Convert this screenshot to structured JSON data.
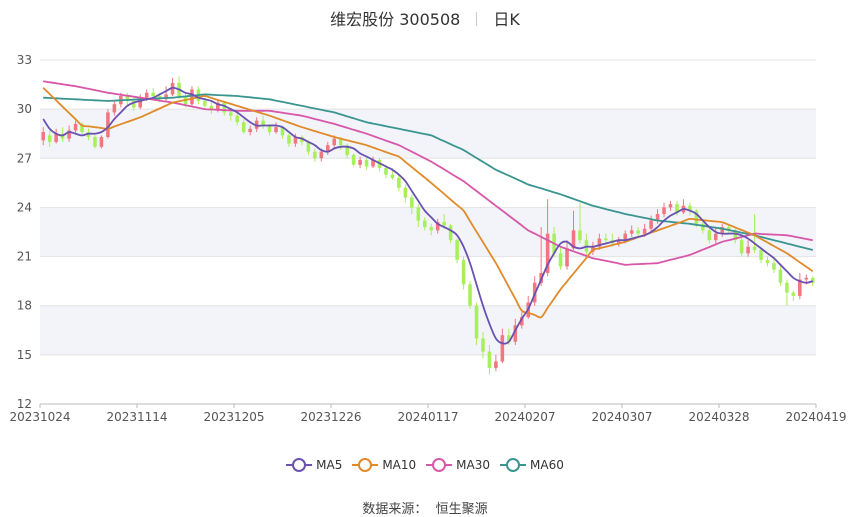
{
  "header": {
    "stock": "维宏股份 300508",
    "period": "日K"
  },
  "source": {
    "label": "数据来源：",
    "name": "恒生聚源"
  },
  "chart_data": {
    "type": "candlestick",
    "yaxis": {
      "min": 12,
      "max": 33,
      "ticks": [
        "12",
        "15",
        "18",
        "21",
        "24",
        "27",
        "30",
        "33"
      ]
    },
    "xaxis_labels": [
      "20231024",
      "20231114",
      "20231205",
      "20231226",
      "20240117",
      "20240207",
      "20240307",
      "20240328",
      "20240419"
    ],
    "colors": {
      "up": "#f0767f",
      "down": "#a8f05a",
      "ma5": "#6a52b0",
      "ma10": "#e08a2a",
      "ma30": "#d857a8",
      "ma60": "#3a9590"
    },
    "legend": [
      {
        "key": "ma5",
        "label": "MA5"
      },
      {
        "key": "ma10",
        "label": "MA10"
      },
      {
        "key": "ma30",
        "label": "MA30"
      },
      {
        "key": "ma60",
        "label": "MA60"
      }
    ],
    "candles": [
      [
        28.1,
        28.6,
        28.9,
        27.8
      ],
      [
        28.4,
        28.0,
        28.7,
        27.7
      ],
      [
        28.0,
        28.5,
        28.8,
        27.9
      ],
      [
        28.5,
        28.2,
        28.9,
        28.0
      ],
      [
        28.2,
        28.7,
        29.0,
        28.0
      ],
      [
        28.7,
        29.1,
        29.3,
        28.5
      ],
      [
        29.1,
        28.6,
        29.2,
        28.4
      ],
      [
        28.6,
        28.3,
        28.8,
        28.1
      ],
      [
        28.3,
        27.7,
        28.4,
        27.6
      ],
      [
        27.7,
        28.3,
        28.4,
        27.6
      ],
      [
        28.3,
        29.8,
        30.0,
        28.2
      ],
      [
        29.8,
        30.3,
        30.5,
        29.6
      ],
      [
        30.3,
        30.8,
        31.0,
        30.1
      ],
      [
        30.8,
        30.5,
        31.0,
        30.2
      ],
      [
        30.5,
        30.1,
        30.7,
        29.9
      ],
      [
        30.1,
        30.7,
        30.9,
        30.0
      ],
      [
        30.7,
        31.0,
        31.2,
        30.5
      ],
      [
        31.0,
        30.8,
        31.3,
        30.6
      ],
      [
        30.8,
        30.6,
        31.0,
        30.4
      ],
      [
        30.6,
        30.9,
        31.4,
        30.5
      ],
      [
        30.9,
        31.6,
        31.9,
        30.8
      ],
      [
        31.6,
        30.8,
        32.0,
        30.6
      ],
      [
        30.8,
        30.3,
        31.0,
        30.1
      ],
      [
        30.3,
        31.2,
        31.4,
        30.2
      ],
      [
        31.2,
        30.5,
        31.4,
        30.3
      ],
      [
        30.5,
        30.2,
        30.7,
        30.0
      ],
      [
        30.2,
        30.0,
        30.4,
        29.7
      ],
      [
        30.0,
        30.4,
        30.6,
        29.8
      ],
      [
        30.4,
        29.8,
        30.5,
        29.6
      ],
      [
        29.8,
        29.6,
        30.0,
        29.3
      ],
      [
        29.6,
        29.2,
        29.8,
        29.0
      ],
      [
        29.2,
        28.6,
        29.4,
        28.5
      ],
      [
        28.6,
        28.8,
        29.0,
        28.4
      ],
      [
        28.8,
        29.3,
        29.5,
        28.6
      ],
      [
        29.3,
        29.0,
        29.6,
        28.8
      ],
      [
        29.0,
        28.6,
        29.1,
        28.4
      ],
      [
        28.6,
        28.9,
        29.2,
        28.5
      ],
      [
        28.9,
        28.4,
        29.0,
        28.2
      ],
      [
        28.4,
        27.9,
        28.5,
        27.7
      ],
      [
        27.9,
        28.3,
        28.5,
        27.7
      ],
      [
        28.3,
        28.0,
        28.4,
        27.8
      ],
      [
        28.0,
        27.4,
        28.1,
        27.2
      ],
      [
        27.4,
        27.0,
        27.6,
        26.8
      ],
      [
        27.0,
        27.4,
        27.6,
        26.8
      ],
      [
        27.4,
        27.8,
        28.0,
        27.2
      ],
      [
        27.8,
        28.2,
        28.4,
        27.6
      ],
      [
        28.2,
        27.8,
        28.3,
        27.5
      ],
      [
        27.8,
        27.2,
        27.9,
        27.0
      ],
      [
        27.2,
        26.6,
        27.3,
        26.5
      ],
      [
        26.6,
        26.9,
        27.1,
        26.4
      ],
      [
        26.9,
        26.5,
        27.0,
        26.3
      ],
      [
        26.5,
        26.9,
        27.1,
        26.4
      ],
      [
        26.9,
        26.4,
        27.0,
        26.2
      ],
      [
        26.4,
        26.0,
        26.6,
        25.8
      ],
      [
        26.0,
        25.8,
        26.4,
        25.7
      ],
      [
        25.8,
        25.2,
        26.0,
        25.0
      ],
      [
        25.2,
        24.6,
        25.4,
        24.3
      ],
      [
        24.6,
        24.0,
        24.8,
        23.6
      ],
      [
        24.0,
        23.2,
        24.2,
        22.8
      ],
      [
        23.2,
        22.8,
        23.4,
        22.6
      ],
      [
        22.8,
        22.6,
        23.0,
        22.3
      ],
      [
        22.6,
        23.1,
        23.3,
        22.4
      ],
      [
        23.1,
        22.9,
        23.6,
        22.7
      ],
      [
        22.9,
        22.0,
        23.0,
        21.8
      ],
      [
        22.0,
        20.8,
        22.1,
        20.6
      ],
      [
        20.8,
        19.3,
        21.0,
        19.0
      ],
      [
        19.3,
        18.0,
        19.5,
        17.8
      ],
      [
        18.0,
        16.0,
        18.2,
        15.6
      ],
      [
        16.0,
        15.2,
        16.4,
        14.8
      ],
      [
        15.2,
        14.2,
        15.6,
        13.8
      ],
      [
        14.2,
        14.6,
        15.0,
        14.0
      ],
      [
        14.6,
        16.2,
        16.6,
        14.5
      ],
      [
        16.2,
        15.8,
        16.6,
        15.6
      ],
      [
        15.8,
        16.8,
        17.2,
        15.6
      ],
      [
        16.8,
        17.3,
        17.6,
        16.6
      ],
      [
        17.3,
        18.2,
        18.6,
        17.2
      ],
      [
        18.2,
        19.4,
        19.8,
        18.0
      ],
      [
        19.4,
        20.0,
        22.8,
        19.2
      ],
      [
        20.0,
        22.4,
        24.5,
        19.8
      ],
      [
        22.4,
        21.2,
        22.8,
        21.0
      ],
      [
        21.2,
        20.4,
        21.6,
        20.2
      ],
      [
        20.4,
        21.5,
        22.0,
        20.2
      ],
      [
        21.5,
        22.6,
        23.8,
        21.4
      ],
      [
        22.6,
        22.0,
        24.3,
        21.8
      ],
      [
        22.0,
        21.3,
        22.4,
        21.1
      ],
      [
        21.3,
        21.6,
        21.9,
        21.1
      ],
      [
        21.6,
        22.1,
        22.4,
        21.4
      ],
      [
        22.1,
        22.0,
        22.4,
        21.8
      ],
      [
        22.0,
        21.8,
        22.4,
        21.6
      ],
      [
        21.8,
        22.0,
        22.2,
        21.6
      ],
      [
        22.0,
        22.4,
        22.6,
        21.8
      ],
      [
        22.4,
        22.6,
        22.9,
        22.2
      ],
      [
        22.6,
        22.4,
        22.8,
        22.2
      ],
      [
        22.4,
        22.7,
        23.0,
        22.2
      ],
      [
        22.7,
        23.2,
        23.5,
        22.5
      ],
      [
        23.2,
        23.6,
        23.9,
        23.0
      ],
      [
        23.6,
        24.0,
        24.3,
        23.4
      ],
      [
        24.0,
        24.2,
        24.4,
        23.8
      ],
      [
        24.2,
        23.7,
        24.4,
        23.5
      ],
      [
        23.7,
        24.1,
        24.5,
        23.6
      ],
      [
        24.1,
        23.8,
        24.3,
        23.5
      ],
      [
        23.8,
        23.0,
        23.9,
        22.8
      ],
      [
        23.0,
        22.6,
        23.2,
        22.4
      ],
      [
        22.6,
        22.0,
        22.8,
        21.8
      ],
      [
        22.0,
        22.4,
        22.7,
        21.8
      ],
      [
        22.4,
        22.8,
        23.0,
        22.2
      ],
      [
        22.8,
        22.6,
        23.0,
        22.4
      ],
      [
        22.6,
        22.0,
        22.7,
        21.8
      ],
      [
        22.0,
        21.2,
        22.2,
        21.0
      ],
      [
        21.2,
        21.6,
        22.0,
        21.0
      ],
      [
        21.6,
        21.4,
        23.6,
        21.2
      ],
      [
        21.4,
        20.8,
        21.6,
        20.6
      ],
      [
        20.8,
        20.6,
        21.0,
        20.4
      ],
      [
        20.6,
        20.2,
        21.0,
        20.0
      ],
      [
        20.2,
        19.4,
        20.4,
        19.2
      ],
      [
        19.4,
        18.8,
        19.6,
        18.0
      ],
      [
        18.8,
        18.6,
        18.9,
        18.3
      ],
      [
        18.6,
        19.6,
        20.0,
        18.4
      ],
      [
        19.6,
        19.7,
        19.9,
        19.3
      ],
      [
        19.7,
        19.4,
        19.8,
        19.2
      ]
    ],
    "ma5": [
      29.4,
      28.8,
      28.5,
      28.4,
      28.6,
      28.5,
      28.4,
      28.5,
      28.5,
      28.6,
      28.9,
      29.4,
      29.8,
      30.2,
      30.4,
      30.5,
      30.6,
      30.7,
      30.9,
      31.1,
      31.3,
      31.2,
      31.0,
      30.9,
      30.7,
      30.6,
      30.5,
      30.3,
      30.2,
      30.0,
      29.8,
      29.5,
      29.2,
      29.0,
      29.0,
      29.0,
      29.0,
      28.9,
      28.6,
      28.3,
      28.2,
      28.0,
      27.8,
      27.5,
      27.4,
      27.6,
      27.7,
      27.7,
      27.6,
      27.3,
      27.1,
      26.9,
      26.7,
      26.5,
      26.3,
      26.0,
      25.6,
      25.0,
      24.4,
      23.8,
      23.4,
      23.0,
      22.8,
      22.6,
      22.3,
      21.6,
      20.6,
      19.3,
      18.0,
      16.9,
      16.0,
      15.7,
      15.8,
      16.5,
      17.2,
      17.8,
      18.7,
      19.6,
      20.5,
      21.2,
      21.8,
      21.9,
      21.6,
      21.5,
      21.6,
      21.6,
      21.7,
      21.8,
      21.9,
      22.0,
      22.0,
      22.1,
      22.2,
      22.3,
      22.5,
      22.8,
      23.2,
      23.5,
      23.7,
      23.9,
      23.8,
      23.6,
      23.2,
      22.8,
      22.5,
      22.4,
      22.4,
      22.4,
      22.3,
      22.1,
      21.8,
      21.5,
      21.2,
      20.9,
      20.5,
      20.1,
      19.7,
      19.5,
      19.4,
      19.5
    ]
  },
  "ma_config": {
    "ma10": {
      "start": 31.3,
      "pts": [
        [
          0,
          31.3
        ],
        [
          6,
          29.0
        ],
        [
          10,
          28.8
        ],
        [
          15,
          29.5
        ],
        [
          20,
          30.4
        ],
        [
          25,
          30.8
        ],
        [
          30,
          30.2
        ],
        [
          35,
          29.6
        ],
        [
          40,
          28.9
        ],
        [
          45,
          28.3
        ],
        [
          50,
          27.8
        ],
        [
          55,
          27.1
        ],
        [
          60,
          25.5
        ],
        [
          65,
          23.8
        ],
        [
          70,
          20.6
        ],
        [
          74,
          17.7
        ],
        [
          77,
          17.3
        ],
        [
          80,
          19.0
        ],
        [
          85,
          21.4
        ],
        [
          90,
          21.9
        ],
        [
          95,
          22.6
        ],
        [
          100,
          23.3
        ],
        [
          105,
          23.1
        ],
        [
          110,
          22.3
        ],
        [
          115,
          21.2
        ],
        [
          119,
          20.1
        ]
      ]
    },
    "ma30": {
      "pts": [
        [
          0,
          31.7
        ],
        [
          5,
          31.4
        ],
        [
          10,
          31.0
        ],
        [
          15,
          30.7
        ],
        [
          20,
          30.4
        ],
        [
          25,
          30.0
        ],
        [
          30,
          29.9
        ],
        [
          35,
          29.9
        ],
        [
          40,
          29.6
        ],
        [
          45,
          29.1
        ],
        [
          50,
          28.5
        ],
        [
          55,
          27.8
        ],
        [
          60,
          26.8
        ],
        [
          65,
          25.6
        ],
        [
          70,
          24.1
        ],
        [
          75,
          22.6
        ],
        [
          80,
          21.6
        ],
        [
          85,
          20.9
        ],
        [
          90,
          20.5
        ],
        [
          95,
          20.6
        ],
        [
          100,
          21.1
        ],
        [
          105,
          21.9
        ],
        [
          110,
          22.4
        ],
        [
          115,
          22.3
        ],
        [
          119,
          22.0
        ]
      ]
    },
    "ma60": {
      "pts": [
        [
          0,
          30.7
        ],
        [
          10,
          30.5
        ],
        [
          20,
          30.7
        ],
        [
          25,
          30.9
        ],
        [
          30,
          30.8
        ],
        [
          35,
          30.6
        ],
        [
          40,
          30.2
        ],
        [
          45,
          29.8
        ],
        [
          50,
          29.2
        ],
        [
          55,
          28.8
        ],
        [
          60,
          28.4
        ],
        [
          65,
          27.5
        ],
        [
          70,
          26.3
        ],
        [
          75,
          25.4
        ],
        [
          80,
          24.8
        ],
        [
          85,
          24.1
        ],
        [
          90,
          23.6
        ],
        [
          95,
          23.2
        ],
        [
          100,
          23.0
        ],
        [
          105,
          22.7
        ],
        [
          110,
          22.3
        ],
        [
          115,
          21.8
        ],
        [
          119,
          21.4
        ]
      ]
    }
  }
}
